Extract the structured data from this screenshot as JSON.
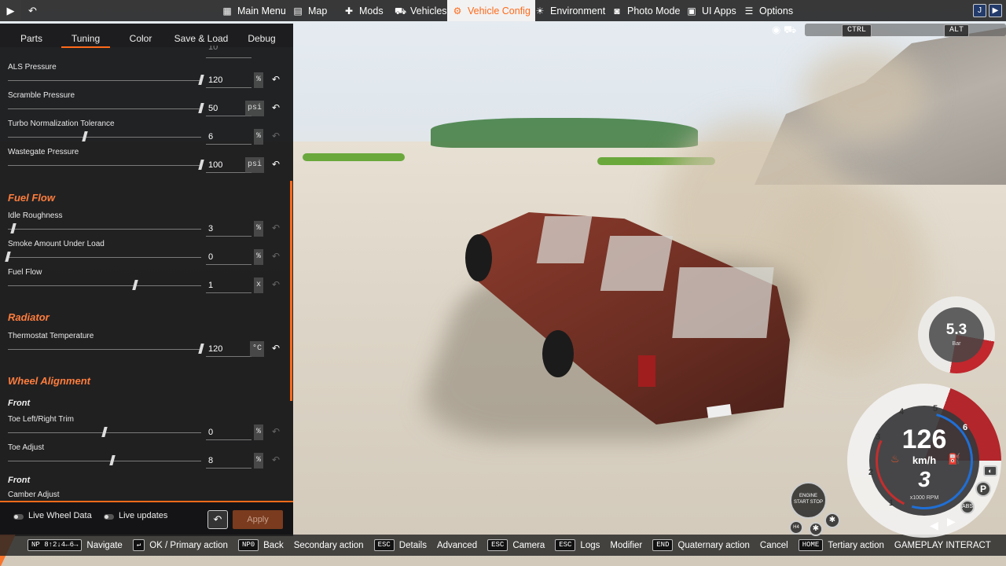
{
  "topbar": {
    "play_icon": "play-icon",
    "undo_icon": "undo-icon",
    "items": [
      {
        "label": "Main Menu",
        "icon": "grid-icon"
      },
      {
        "label": "Map",
        "icon": "map-icon"
      },
      {
        "label": "Mods",
        "icon": "puzzle-icon"
      },
      {
        "label": "Vehicles",
        "icon": "car-icon"
      },
      {
        "label": "Vehicle Config",
        "icon": "engine-icon",
        "active": true
      },
      {
        "label": "Environment",
        "icon": "sun-icon"
      },
      {
        "label": "Photo Mode",
        "icon": "camera-icon"
      },
      {
        "label": "UI Apps",
        "icon": "apps-icon"
      },
      {
        "label": "Options",
        "icon": "sliders-icon"
      }
    ],
    "accent_color": "#ff6a1a"
  },
  "viewport": {
    "ctrl_key": "CTRL",
    "alt_key": "ALT"
  },
  "panel": {
    "tabs": [
      "Parts",
      "Tuning",
      "Color",
      "Save & Load",
      "Debug"
    ],
    "active_tab": "Tuning",
    "partial_top_value": "10",
    "rows": [
      {
        "label": "ALS Pressure",
        "value": "120",
        "unit": "%",
        "level": 1.0,
        "reset_active": true
      },
      {
        "label": "Scramble Pressure",
        "value": "50",
        "unit": "psi",
        "level": 1.0,
        "reset_active": true
      },
      {
        "label": "Turbo Normalization Tolerance",
        "value": "6",
        "unit": "%",
        "level": 0.4,
        "reset_active": false
      },
      {
        "label": "Wastegate Pressure",
        "value": "100",
        "unit": "psi",
        "level": 1.0,
        "reset_active": true
      }
    ],
    "sections": {
      "fuel_flow": "Fuel Flow",
      "radiator": "Radiator",
      "wheel_alignment": "Wheel Alignment",
      "front_1": "Front",
      "front_2": "Front"
    },
    "fuel_rows": [
      {
        "label": "Idle Roughness",
        "value": "3",
        "unit": "%",
        "level": 0.03,
        "reset_active": false
      },
      {
        "label": "Smoke Amount Under Load",
        "value": "0",
        "unit": "%",
        "level": 0.0,
        "reset_active": false
      },
      {
        "label": "Fuel Flow",
        "value": "1",
        "unit": "x",
        "level": 0.66,
        "reset_active": false
      }
    ],
    "radiator_rows": [
      {
        "label": "Thermostat Temperature",
        "value": "120",
        "unit": "°C",
        "level": 1.0,
        "reset_active": true
      }
    ],
    "alignment_rows": [
      {
        "label": "Toe Left/Right Trim",
        "value": "0",
        "unit": "%",
        "level": 0.5,
        "reset_active": false
      },
      {
        "label": "Toe Adjust",
        "value": "8",
        "unit": "%",
        "level": 0.54,
        "reset_active": false
      }
    ],
    "camber_label": "Camber Adjust",
    "footer": {
      "live_wheel_data": "Live Wheel Data",
      "live_updates": "Live updates",
      "apply": "Apply"
    }
  },
  "bottombar": {
    "hints": [
      {
        "key": "NP 8↑2↓4←6→",
        "label": "Navigate"
      },
      {
        "key": "↵",
        "label": "OK / Primary action"
      },
      {
        "key": "NP0",
        "label": "Back"
      },
      {
        "key": "",
        "label": "Secondary action"
      },
      {
        "key": "ESC",
        "label": "Details"
      },
      {
        "key": "",
        "label": "Advanced"
      },
      {
        "key": "ESC",
        "label": "Camera"
      },
      {
        "key": "ESC",
        "label": "Logs"
      },
      {
        "key": "",
        "label": "Modifier"
      },
      {
        "key": "END",
        "label": "Quaternary action"
      },
      {
        "key": "",
        "label": "Cancel"
      },
      {
        "key": "HOME",
        "label": "Tertiary action"
      },
      {
        "key": "",
        "label": "GAMEPLAY INTERACT"
      }
    ]
  },
  "hud": {
    "boost_value": "5.3",
    "boost_unit": "Bar",
    "speed": "126",
    "speed_unit": "km/h",
    "gear": "3",
    "rpm_unit": "x1000 RPM",
    "rpm_ticks": [
      "1",
      "2",
      "3",
      "4",
      "5",
      "6"
    ],
    "parking": "P",
    "abs": "ABS",
    "engine_button": "ENGINE START STOP",
    "h4": "H4",
    "red_zone_color": "#c1272d",
    "blue_arc_color": "#1f6fd6"
  }
}
